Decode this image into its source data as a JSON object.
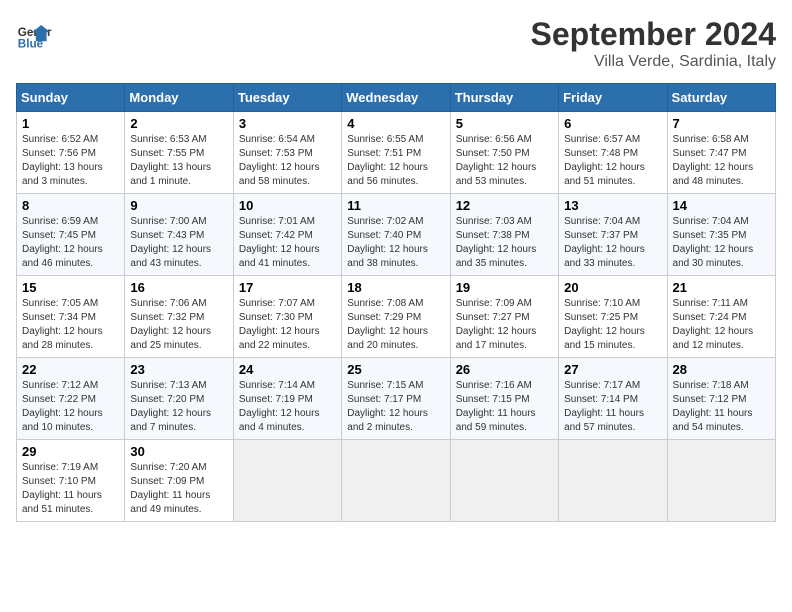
{
  "header": {
    "logo_line1": "General",
    "logo_line2": "Blue",
    "month_title": "September 2024",
    "location": "Villa Verde, Sardinia, Italy"
  },
  "calendar": {
    "days_of_week": [
      "Sunday",
      "Monday",
      "Tuesday",
      "Wednesday",
      "Thursday",
      "Friday",
      "Saturday"
    ],
    "weeks": [
      [
        {
          "day": "",
          "empty": true
        },
        {
          "day": "",
          "empty": true
        },
        {
          "day": "",
          "empty": true
        },
        {
          "day": "",
          "empty": true
        },
        {
          "day": "",
          "empty": true
        },
        {
          "day": "",
          "empty": true
        },
        {
          "day": "",
          "empty": true
        }
      ],
      [
        {
          "day": "1",
          "sunrise": "6:52 AM",
          "sunset": "7:56 PM",
          "daylight": "13 hours and 3 minutes."
        },
        {
          "day": "2",
          "sunrise": "6:53 AM",
          "sunset": "7:55 PM",
          "daylight": "13 hours and 1 minute."
        },
        {
          "day": "3",
          "sunrise": "6:54 AM",
          "sunset": "7:53 PM",
          "daylight": "12 hours and 58 minutes."
        },
        {
          "day": "4",
          "sunrise": "6:55 AM",
          "sunset": "7:51 PM",
          "daylight": "12 hours and 56 minutes."
        },
        {
          "day": "5",
          "sunrise": "6:56 AM",
          "sunset": "7:50 PM",
          "daylight": "12 hours and 53 minutes."
        },
        {
          "day": "6",
          "sunrise": "6:57 AM",
          "sunset": "7:48 PM",
          "daylight": "12 hours and 51 minutes."
        },
        {
          "day": "7",
          "sunrise": "6:58 AM",
          "sunset": "7:47 PM",
          "daylight": "12 hours and 48 minutes."
        }
      ],
      [
        {
          "day": "8",
          "sunrise": "6:59 AM",
          "sunset": "7:45 PM",
          "daylight": "12 hours and 46 minutes."
        },
        {
          "day": "9",
          "sunrise": "7:00 AM",
          "sunset": "7:43 PM",
          "daylight": "12 hours and 43 minutes."
        },
        {
          "day": "10",
          "sunrise": "7:01 AM",
          "sunset": "7:42 PM",
          "daylight": "12 hours and 41 minutes."
        },
        {
          "day": "11",
          "sunrise": "7:02 AM",
          "sunset": "7:40 PM",
          "daylight": "12 hours and 38 minutes."
        },
        {
          "day": "12",
          "sunrise": "7:03 AM",
          "sunset": "7:38 PM",
          "daylight": "12 hours and 35 minutes."
        },
        {
          "day": "13",
          "sunrise": "7:04 AM",
          "sunset": "7:37 PM",
          "daylight": "12 hours and 33 minutes."
        },
        {
          "day": "14",
          "sunrise": "7:04 AM",
          "sunset": "7:35 PM",
          "daylight": "12 hours and 30 minutes."
        }
      ],
      [
        {
          "day": "15",
          "sunrise": "7:05 AM",
          "sunset": "7:34 PM",
          "daylight": "12 hours and 28 minutes."
        },
        {
          "day": "16",
          "sunrise": "7:06 AM",
          "sunset": "7:32 PM",
          "daylight": "12 hours and 25 minutes."
        },
        {
          "day": "17",
          "sunrise": "7:07 AM",
          "sunset": "7:30 PM",
          "daylight": "12 hours and 22 minutes."
        },
        {
          "day": "18",
          "sunrise": "7:08 AM",
          "sunset": "7:29 PM",
          "daylight": "12 hours and 20 minutes."
        },
        {
          "day": "19",
          "sunrise": "7:09 AM",
          "sunset": "7:27 PM",
          "daylight": "12 hours and 17 minutes."
        },
        {
          "day": "20",
          "sunrise": "7:10 AM",
          "sunset": "7:25 PM",
          "daylight": "12 hours and 15 minutes."
        },
        {
          "day": "21",
          "sunrise": "7:11 AM",
          "sunset": "7:24 PM",
          "daylight": "12 hours and 12 minutes."
        }
      ],
      [
        {
          "day": "22",
          "sunrise": "7:12 AM",
          "sunset": "7:22 PM",
          "daylight": "12 hours and 10 minutes."
        },
        {
          "day": "23",
          "sunrise": "7:13 AM",
          "sunset": "7:20 PM",
          "daylight": "12 hours and 7 minutes."
        },
        {
          "day": "24",
          "sunrise": "7:14 AM",
          "sunset": "7:19 PM",
          "daylight": "12 hours and 4 minutes."
        },
        {
          "day": "25",
          "sunrise": "7:15 AM",
          "sunset": "7:17 PM",
          "daylight": "12 hours and 2 minutes."
        },
        {
          "day": "26",
          "sunrise": "7:16 AM",
          "sunset": "7:15 PM",
          "daylight": "11 hours and 59 minutes."
        },
        {
          "day": "27",
          "sunrise": "7:17 AM",
          "sunset": "7:14 PM",
          "daylight": "11 hours and 57 minutes."
        },
        {
          "day": "28",
          "sunrise": "7:18 AM",
          "sunset": "7:12 PM",
          "daylight": "11 hours and 54 minutes."
        }
      ],
      [
        {
          "day": "29",
          "sunrise": "7:19 AM",
          "sunset": "7:10 PM",
          "daylight": "11 hours and 51 minutes."
        },
        {
          "day": "30",
          "sunrise": "7:20 AM",
          "sunset": "7:09 PM",
          "daylight": "11 hours and 49 minutes."
        },
        {
          "day": "",
          "empty": true
        },
        {
          "day": "",
          "empty": true
        },
        {
          "day": "",
          "empty": true
        },
        {
          "day": "",
          "empty": true
        },
        {
          "day": "",
          "empty": true
        }
      ]
    ]
  }
}
